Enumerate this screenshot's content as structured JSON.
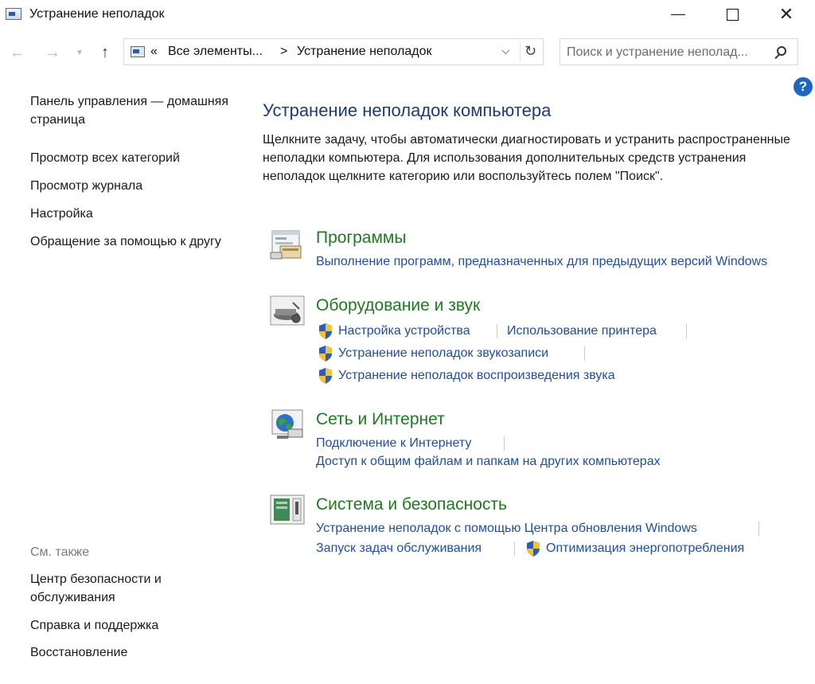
{
  "window": {
    "title": "Устранение неполадок",
    "minimize_symbol": "—",
    "close_symbol": "✕"
  },
  "nav": {
    "back_symbol": "←",
    "forward_symbol": "→",
    "up_symbol": "↑",
    "breadcrumb_prefix": "«",
    "breadcrumb_parent": "Все элементы...",
    "breadcrumb_separator": ">",
    "breadcrumb_current": "Устранение неполадок",
    "refresh_symbol": "↻",
    "search_placeholder": "Поиск и устранение неполад..."
  },
  "help_symbol": "?",
  "sidebar": {
    "home": "Панель управления — домашняя страница",
    "links": [
      "Просмотр всех категорий",
      "Просмотр журнала",
      "Настройка",
      "Обращение за помощью к другу"
    ],
    "see_also_label": "См. также",
    "see_also": [
      "Центр безопасности и обслуживания",
      "Справка и поддержка",
      "Восстановление"
    ]
  },
  "main": {
    "title": "Устранение неполадок компьютера",
    "description": "Щелкните задачу, чтобы автоматически диагностировать и устранить распространенные неполадки компьютера. Для использования дополнительных средств устранения неполадок щелкните категорию или воспользуйтесь полем \"Поиск\".",
    "categories": [
      {
        "title": "Программы",
        "icon": "programs-icon",
        "links": [
          "Выполнение программ, предназначенных для предыдущих версий Windows"
        ]
      },
      {
        "title": "Оборудование и звук",
        "icon": "hardware-sound-icon",
        "links": [
          "Настройка устройства",
          "Использование принтера",
          "Устранение неполадок звукозаписи",
          "Устранение неполадок воспроизведения звука"
        ]
      },
      {
        "title": "Сеть и Интернет",
        "icon": "network-internet-icon",
        "links": [
          "Подключение к Интернету",
          "Доступ к общим файлам и папкам на других компьютерах"
        ]
      },
      {
        "title": "Система и безопасность",
        "icon": "system-security-icon",
        "links": [
          "Устранение неполадок с помощью Центра обновления Windows",
          "Запуск задач обслуживания",
          "Оптимизация энергопотребления"
        ]
      }
    ]
  }
}
